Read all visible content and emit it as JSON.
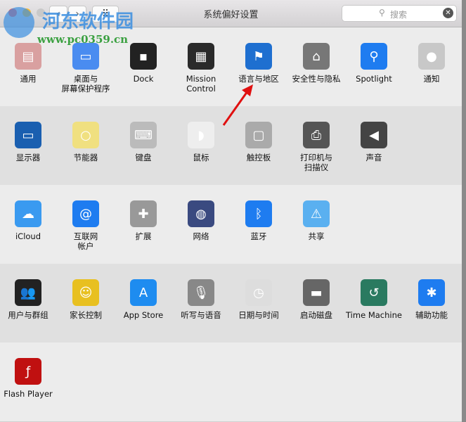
{
  "window": {
    "title": "系统偏好设置",
    "search_placeholder": "搜索",
    "back": "‹",
    "forward": "›",
    "grid": "⠿"
  },
  "watermark": {
    "name": "河东软件园",
    "url": "www.pc0359.cn"
  },
  "sections": [
    [
      {
        "label": "通用",
        "icon": "general-icon",
        "color": "#d9a0a0"
      },
      {
        "label": "桌面与\n屏幕保护程序",
        "icon": "desktop-icon",
        "color": "#4a8cf0"
      },
      {
        "label": "Dock",
        "icon": "dock-icon",
        "color": "#222"
      },
      {
        "label": "Mission\nControl",
        "icon": "mission-control-icon",
        "color": "#2a2a2a"
      },
      {
        "label": "语言与地区",
        "icon": "flag-icon",
        "color": "#1e6fd0"
      },
      {
        "label": "安全性与隐私",
        "icon": "security-house-icon",
        "color": "#777"
      },
      {
        "label": "Spotlight",
        "icon": "spotlight-icon",
        "color": "#1e7cf0"
      },
      {
        "label": "通知",
        "icon": "notifications-icon",
        "color": "#c8c8c8"
      }
    ],
    [
      {
        "label": "显示器",
        "icon": "display-icon",
        "color": "#1a5fb0"
      },
      {
        "label": "节能器",
        "icon": "bulb-icon",
        "color": "#f0e080"
      },
      {
        "label": "键盘",
        "icon": "keyboard-icon",
        "color": "#bbb"
      },
      {
        "label": "鼠标",
        "icon": "mouse-icon",
        "color": "#eee"
      },
      {
        "label": "触控板",
        "icon": "trackpad-icon",
        "color": "#aaa"
      },
      {
        "label": "打印机与\n扫描仪",
        "icon": "printer-icon",
        "color": "#555"
      },
      {
        "label": "声音",
        "icon": "speaker-icon",
        "color": "#444"
      }
    ],
    [
      {
        "label": "iCloud",
        "icon": "icloud-icon",
        "color": "#3a9af0"
      },
      {
        "label": "互联网\n帐户",
        "icon": "at-icon",
        "color": "#1e7cf0"
      },
      {
        "label": "扩展",
        "icon": "puzzle-icon",
        "color": "#999"
      },
      {
        "label": "网络",
        "icon": "globe-icon",
        "color": "#3a4a80"
      },
      {
        "label": "蓝牙",
        "icon": "bluetooth-icon",
        "color": "#1e7cf0"
      },
      {
        "label": "共享",
        "icon": "shared-folder-icon",
        "color": "#5ab0f0"
      }
    ],
    [
      {
        "label": "用户与群组",
        "icon": "users-icon",
        "color": "#222"
      },
      {
        "label": "家长控制",
        "icon": "parental-icon",
        "color": "#e8c020"
      },
      {
        "label": "App Store",
        "icon": "appstore-icon",
        "color": "#1e8cf0"
      },
      {
        "label": "听写与语音",
        "icon": "microphone-icon",
        "color": "#888"
      },
      {
        "label": "日期与时间",
        "icon": "clock-icon",
        "color": "#ddd"
      },
      {
        "label": "启动磁盘",
        "icon": "disk-icon",
        "color": "#666"
      },
      {
        "label": "Time Machine",
        "icon": "time-machine-icon",
        "color": "#2a7a60"
      },
      {
        "label": "辅助功能",
        "icon": "accessibility-icon",
        "color": "#1e7cf0"
      }
    ],
    [
      {
        "label": "Flash Player",
        "icon": "flash-icon",
        "color": "#c01010"
      }
    ]
  ],
  "glyphs": {
    "general-icon": "▤",
    "desktop-icon": "▭",
    "dock-icon": "▪",
    "mission-control-icon": "▦",
    "flag-icon": "⚑",
    "security-house-icon": "⌂",
    "spotlight-icon": "⚲",
    "notifications-icon": "●",
    "display-icon": "▭",
    "bulb-icon": "○",
    "keyboard-icon": "⌨",
    "mouse-icon": "◗",
    "trackpad-icon": "▢",
    "printer-icon": "⎙",
    "speaker-icon": "◀",
    "icloud-icon": "☁",
    "at-icon": "@",
    "puzzle-icon": "✚",
    "globe-icon": "◍",
    "bluetooth-icon": "ᛒ",
    "shared-folder-icon": "⚠",
    "users-icon": "👥",
    "parental-icon": "☺",
    "appstore-icon": "A",
    "microphone-icon": "🎙",
    "clock-icon": "◷",
    "disk-icon": "▬",
    "time-machine-icon": "↺",
    "accessibility-icon": "✱",
    "flash-icon": "ƒ"
  }
}
